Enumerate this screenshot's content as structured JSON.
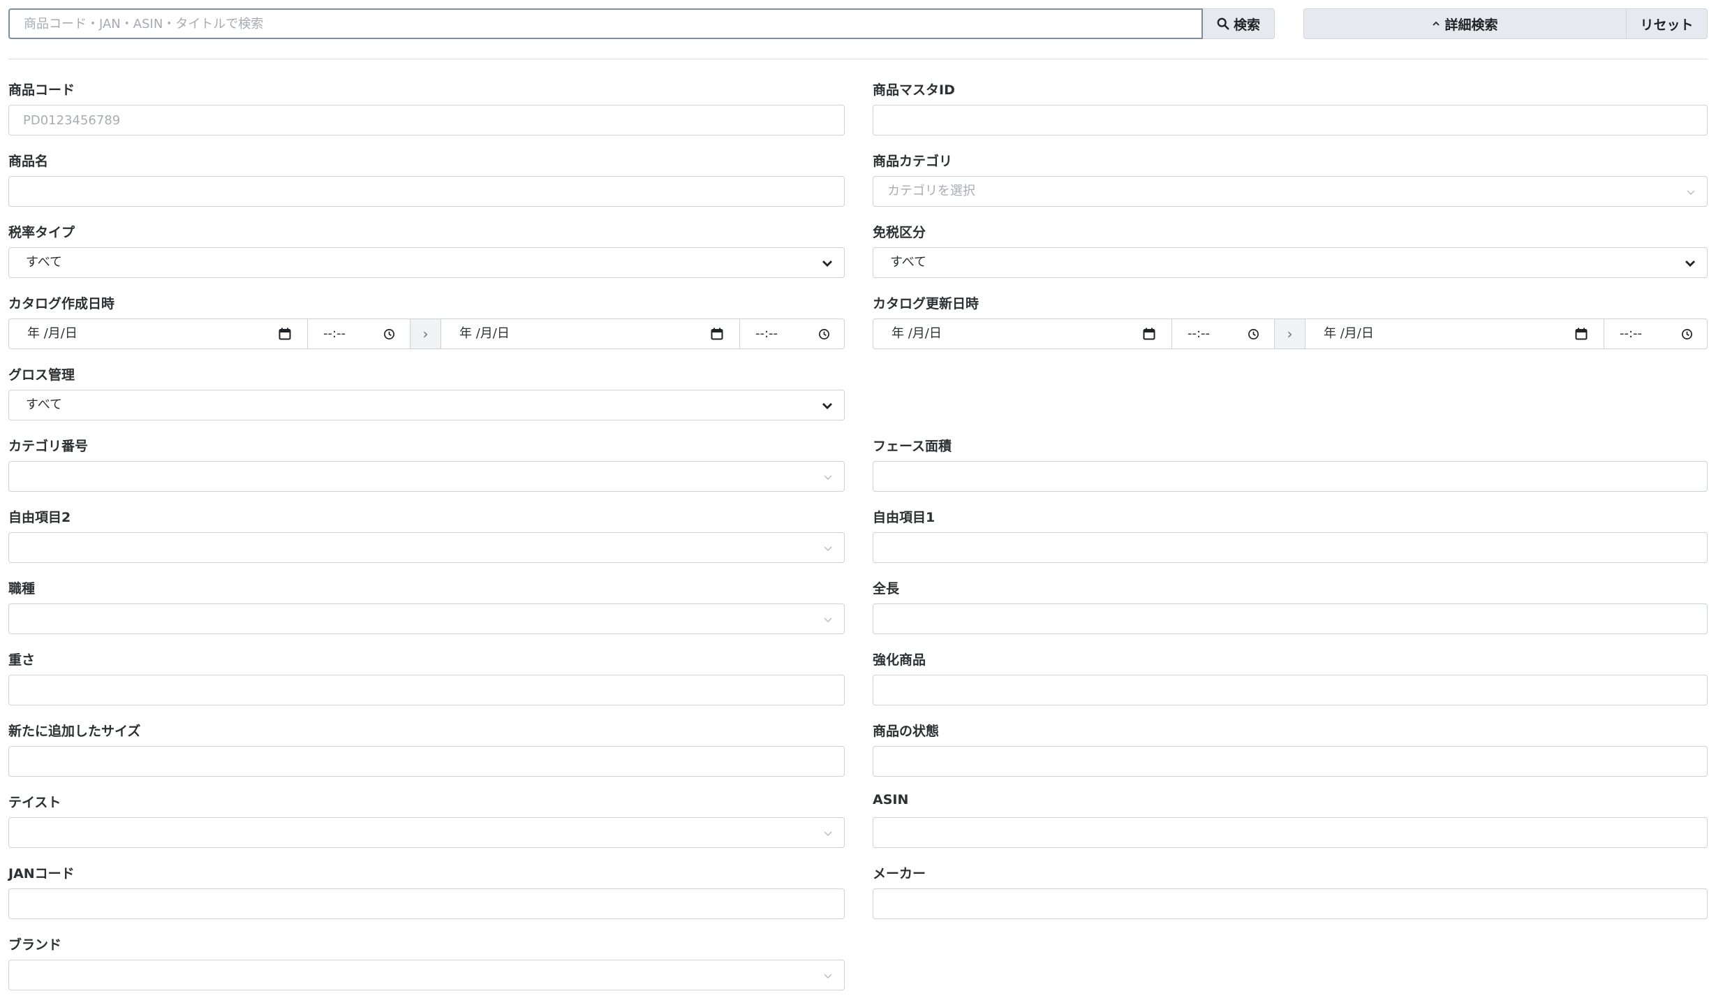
{
  "search": {
    "placeholder": "商品コード・JAN・ASIN・タイトルで検索",
    "search_button": "検索",
    "advanced_button": "詳細検索",
    "reset_button": "リセット"
  },
  "fields": {
    "product_code": {
      "label": "商品コード",
      "placeholder": "PD0123456789"
    },
    "product_master_id": {
      "label": "商品マスタID"
    },
    "product_name": {
      "label": "商品名"
    },
    "product_category": {
      "label": "商品カテゴリ",
      "placeholder": "カテゴリを選択"
    },
    "tax_rate_type": {
      "label": "税率タイプ",
      "value": "すべて"
    },
    "tax_exempt": {
      "label": "免税区分",
      "value": "すべて"
    },
    "catalog_created": {
      "label": "カタログ作成日時",
      "date_placeholder": "年 /月/日",
      "time_placeholder": "--:--",
      "arrow": "›"
    },
    "catalog_updated": {
      "label": "カタログ更新日時",
      "date_placeholder": "年 /月/日",
      "time_placeholder": "--:--",
      "arrow": "›"
    },
    "gross_management": {
      "label": "グロス管理",
      "value": "すべて"
    },
    "category_number": {
      "label": "カテゴリ番号"
    },
    "face_area": {
      "label": "フェース面積"
    },
    "free_item_2": {
      "label": "自由項目2"
    },
    "free_item_1": {
      "label": "自由項目1"
    },
    "job_type": {
      "label": "職種"
    },
    "total_length": {
      "label": "全長"
    },
    "weight": {
      "label": "重さ"
    },
    "featured_product": {
      "label": "強化商品"
    },
    "new_size": {
      "label": "新たに追加したサイズ"
    },
    "product_condition": {
      "label": "商品の状態"
    },
    "taste": {
      "label": "テイスト"
    },
    "asin": {
      "label": "ASIN"
    },
    "jan_code": {
      "label": "JANコード"
    },
    "maker": {
      "label": "メーカー"
    },
    "brand": {
      "label": "ブランド"
    }
  }
}
